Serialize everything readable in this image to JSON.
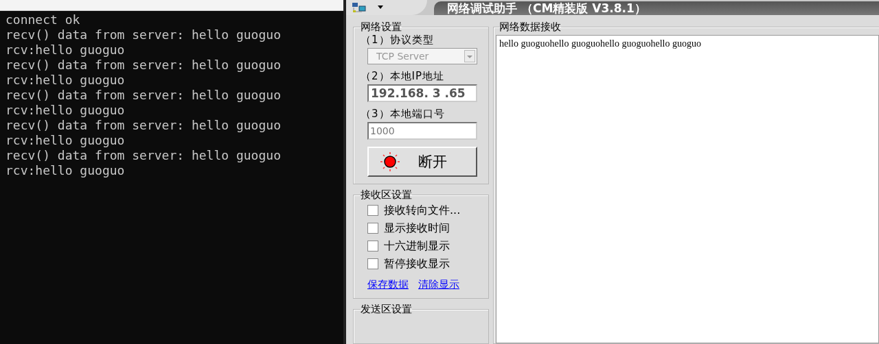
{
  "console": {
    "lines": [
      "connect ok",
      "recv() data from server: hello guoguo",
      "rcv:hello guoguo",
      "recv() data from server: hello guoguo",
      "rcv:hello guoguo",
      "recv() data from server: hello guoguo",
      "rcv:hello guoguo",
      "recv() data from server: hello guoguo",
      "rcv:hello guoguo",
      "recv() data from server: hello guoguo",
      "rcv:hello guoguo"
    ]
  },
  "window": {
    "title": "网络调试助手 （CM精装版 V3.8.1）"
  },
  "network_settings": {
    "title": "网络设置",
    "protocol_label": "（1）协议类型",
    "protocol": "TCP Server",
    "ip_label": "（2）本地IP地址",
    "ip": "192.168. 3 .65",
    "port_label": "（3）本地端口号",
    "port": "1000",
    "connect_button": "断开",
    "connected": true
  },
  "receive_settings": {
    "title": "接收区设置",
    "options": [
      {
        "label": "接收转向文件...",
        "checked": false
      },
      {
        "label": "显示接收时间",
        "checked": false
      },
      {
        "label": "十六进制显示",
        "checked": false
      },
      {
        "label": "暂停接收显示",
        "checked": false
      }
    ],
    "links": [
      "保存数据",
      "清除显示"
    ]
  },
  "send_settings": {
    "title": "发送区设置"
  },
  "receive_area": {
    "title": "网络数据接收",
    "text": "hello guoguohello guoguohello guoguohello guoguo"
  }
}
